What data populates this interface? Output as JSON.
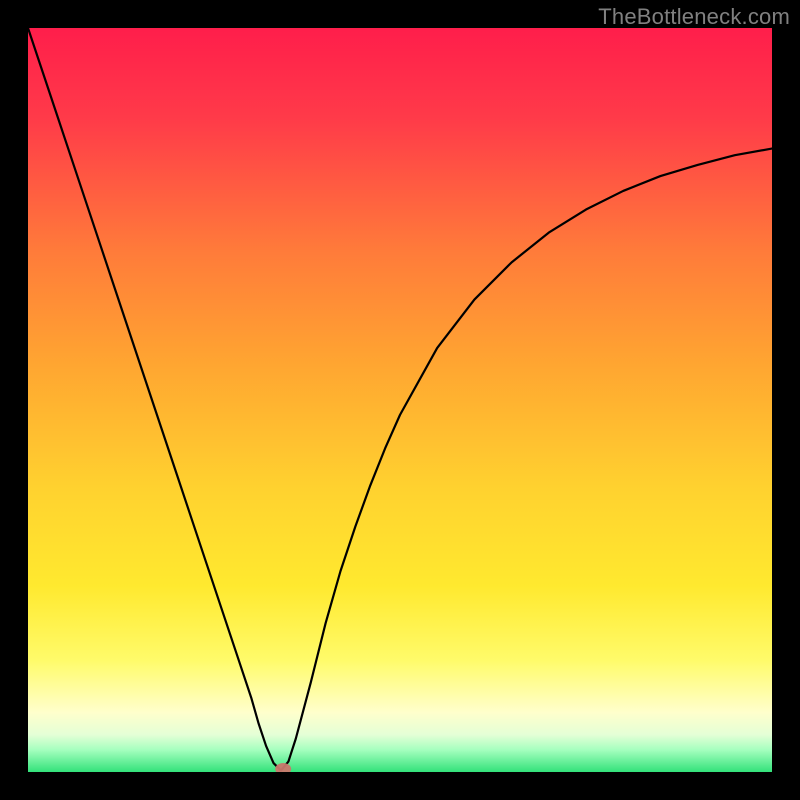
{
  "watermark": "TheBottleneck.com",
  "chart_data": {
    "type": "line",
    "title": "",
    "xlabel": "",
    "ylabel": "",
    "xlim": [
      0,
      100
    ],
    "ylim": [
      0,
      100
    ],
    "grid": false,
    "series": [
      {
        "name": "curve",
        "x": [
          0,
          2,
          4,
          6,
          8,
          10,
          12,
          14,
          16,
          18,
          20,
          22,
          24,
          26,
          28,
          30,
          31,
          32,
          33,
          34,
          35,
          36,
          38,
          40,
          42,
          44,
          46,
          48,
          50,
          55,
          60,
          65,
          70,
          75,
          80,
          85,
          90,
          95,
          100
        ],
        "values": [
          100,
          94,
          88,
          82,
          76,
          70,
          64,
          58,
          52,
          46,
          40,
          34,
          28,
          22,
          16,
          10,
          6.5,
          3.5,
          1.2,
          0.2,
          1.4,
          4.5,
          12,
          20,
          27,
          33,
          38.5,
          43.5,
          48,
          57,
          63.5,
          68.5,
          72.5,
          75.6,
          78.1,
          80.1,
          81.6,
          82.9,
          83.8
        ]
      }
    ],
    "marker": {
      "x": 34.3,
      "y": 0.0,
      "color": "#c9776b"
    },
    "background_gradient": {
      "from_top": [
        "#ff1e4b",
        "#ffa531",
        "#ffe92f",
        "#ffffcc",
        "#33e27a"
      ]
    }
  }
}
